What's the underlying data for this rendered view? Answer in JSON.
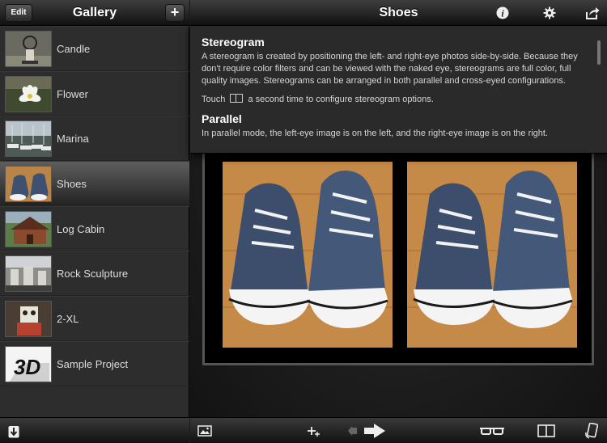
{
  "sidebar": {
    "title": "Gallery",
    "edit_label": "Edit",
    "add_label": "+",
    "items": [
      {
        "label": "Candle",
        "thumb": "candle"
      },
      {
        "label": "Flower",
        "thumb": "flower"
      },
      {
        "label": "Marina",
        "thumb": "marina"
      },
      {
        "label": "Shoes",
        "thumb": "shoes",
        "selected": true
      },
      {
        "label": "Log Cabin",
        "thumb": "cabin"
      },
      {
        "label": "Rock Sculpture",
        "thumb": "rock"
      },
      {
        "label": "2-XL",
        "thumb": "robot"
      },
      {
        "label": "Sample Project",
        "thumb": "3d-logo"
      }
    ]
  },
  "main": {
    "title": "Shoes",
    "popover": {
      "heading1": "Stereogram",
      "para1": "A stereogram is created by positioning the left- and right-eye photos side-by-side. Because they don't require color filters and can be viewed with the naked eye, stereograms are full color, full quality images. Stereograms can be arranged in both parallel and cross-eyed configurations.",
      "touch_prefix": "Touch",
      "touch_suffix": "a second time to configure stereogram options.",
      "heading2": "Parallel",
      "para2": "In parallel mode, the left-eye image is on the left, and the right-eye image is on the right."
    }
  },
  "icons": {
    "info": "info-icon",
    "settings": "gear-icon",
    "share": "share-icon",
    "import": "import-icon",
    "photo": "photo-icon",
    "align": "align-icon",
    "prev": "arrow-left-icon",
    "next": "arrow-right-icon",
    "glasses": "3d-glasses-icon",
    "stereo": "stereogram-icon",
    "rotate": "rotate-device-icon"
  }
}
